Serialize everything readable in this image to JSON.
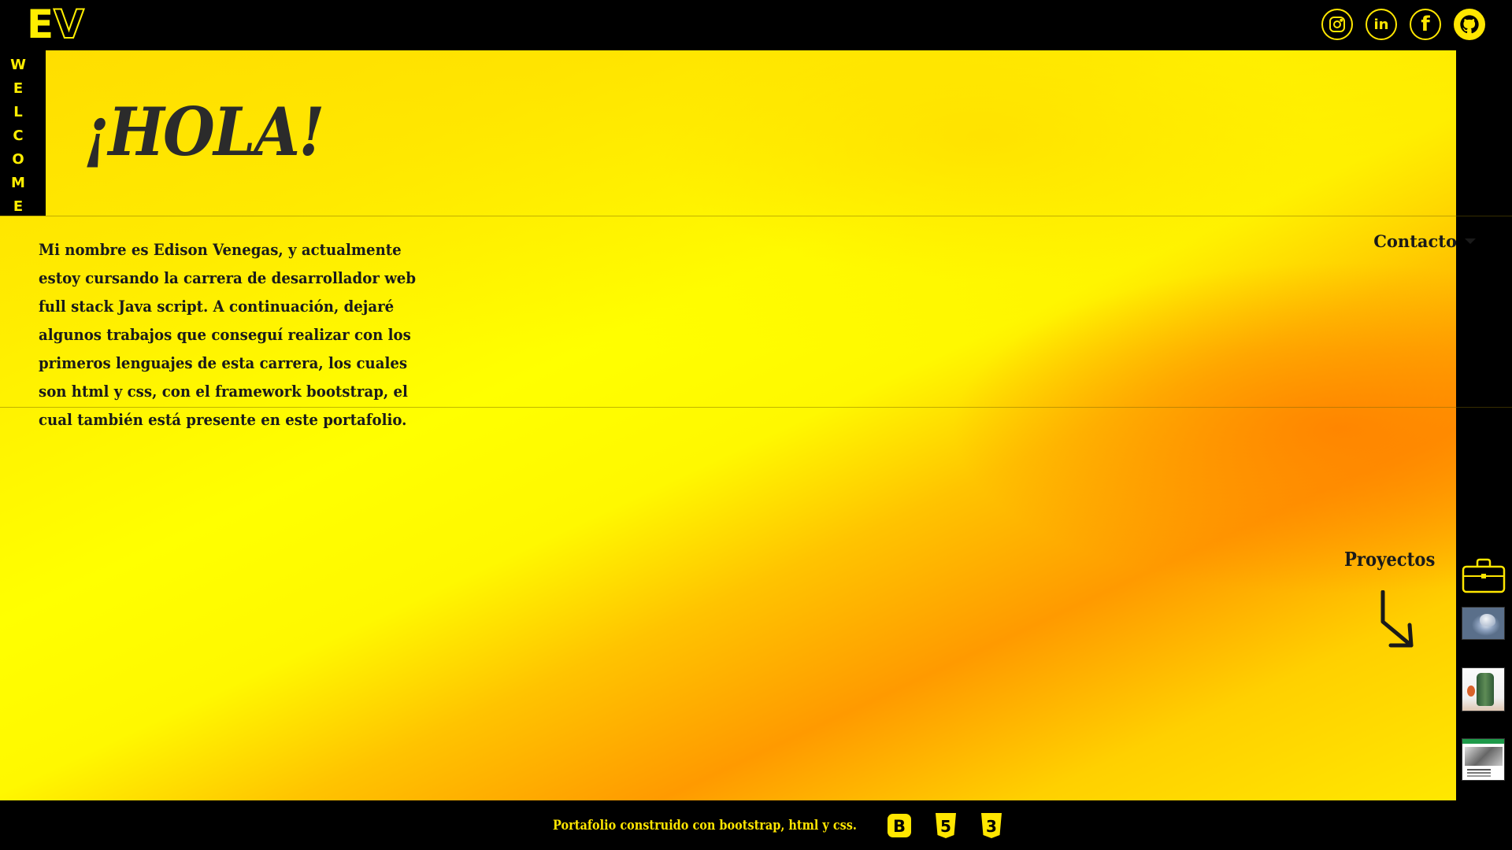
{
  "brand": {
    "logo_e": "E",
    "logo_v": "V"
  },
  "social": [
    {
      "icon": "instagram-icon"
    },
    {
      "icon": "linkedin-icon",
      "text": "in"
    },
    {
      "icon": "facebook-icon",
      "text": "f"
    },
    {
      "icon": "github-icon"
    }
  ],
  "welcome": {
    "letters": [
      "W",
      "E",
      "L",
      "C",
      "O",
      "M",
      "E"
    ]
  },
  "hero": {
    "greeting": "¡HOLA!",
    "intro": "Mi nombre es Edison Venegas, y actualmente estoy cursando la carrera de desarrollador web full stack Java script. A continuación, dejaré algunos trabajos que conseguí realizar con los primeros lenguajes de esta carrera, los cuales son html y css, con el framework bootstrap, el cual también está presente en este portafolio."
  },
  "contact": {
    "label": "Contacto"
  },
  "projects": {
    "label": "Proyectos",
    "thumbnails": [
      "project-thumb-bird",
      "project-thumb-cactus",
      "project-thumb-web"
    ]
  },
  "footer": {
    "text": "Portafolio construido con bootstrap, html y css.",
    "tech_icons": [
      {
        "icon": "bootstrap-icon",
        "text": "B"
      },
      {
        "icon": "html5-icon",
        "text": "5"
      },
      {
        "icon": "css3-icon",
        "text": "3"
      }
    ]
  },
  "colors": {
    "accent": "#ffee00",
    "dark": "#000000",
    "text": "#1a1a1a"
  }
}
